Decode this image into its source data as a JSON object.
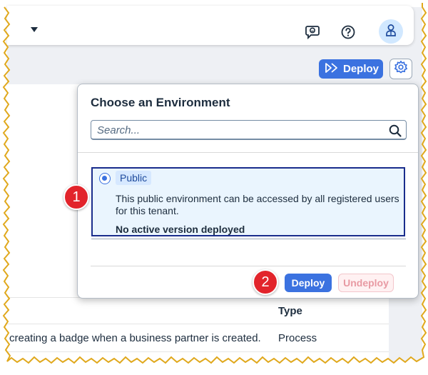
{
  "shell": {
    "notifications_icon": "feedback-smile-icon",
    "help_icon": "help-icon",
    "avatar_icon": "user-icon"
  },
  "toolbar": {
    "deploy_label": "Deploy",
    "deploy_icon": "deploy-arrows-icon",
    "settings_icon": "gear-icon"
  },
  "popover": {
    "title": "Choose an Environment",
    "search_placeholder": "Search...",
    "environment": {
      "name": "Public",
      "description": "This public environment can be accessed by all registered users for this tenant.",
      "status": "No active version deployed",
      "selected": true
    },
    "deploy_label": "Deploy",
    "undeploy_label": "Undeploy"
  },
  "table": {
    "column_type": "Type",
    "rows": [
      {
        "description": "creating a badge when a business partner is created.",
        "type": "Process"
      }
    ]
  },
  "callouts": [
    "1",
    "2"
  ],
  "colors": {
    "accent": "#3b72e0",
    "selection_border": "#1a2d8c",
    "selection_bg": "#eaf5fe",
    "callout": "#e2242b"
  }
}
